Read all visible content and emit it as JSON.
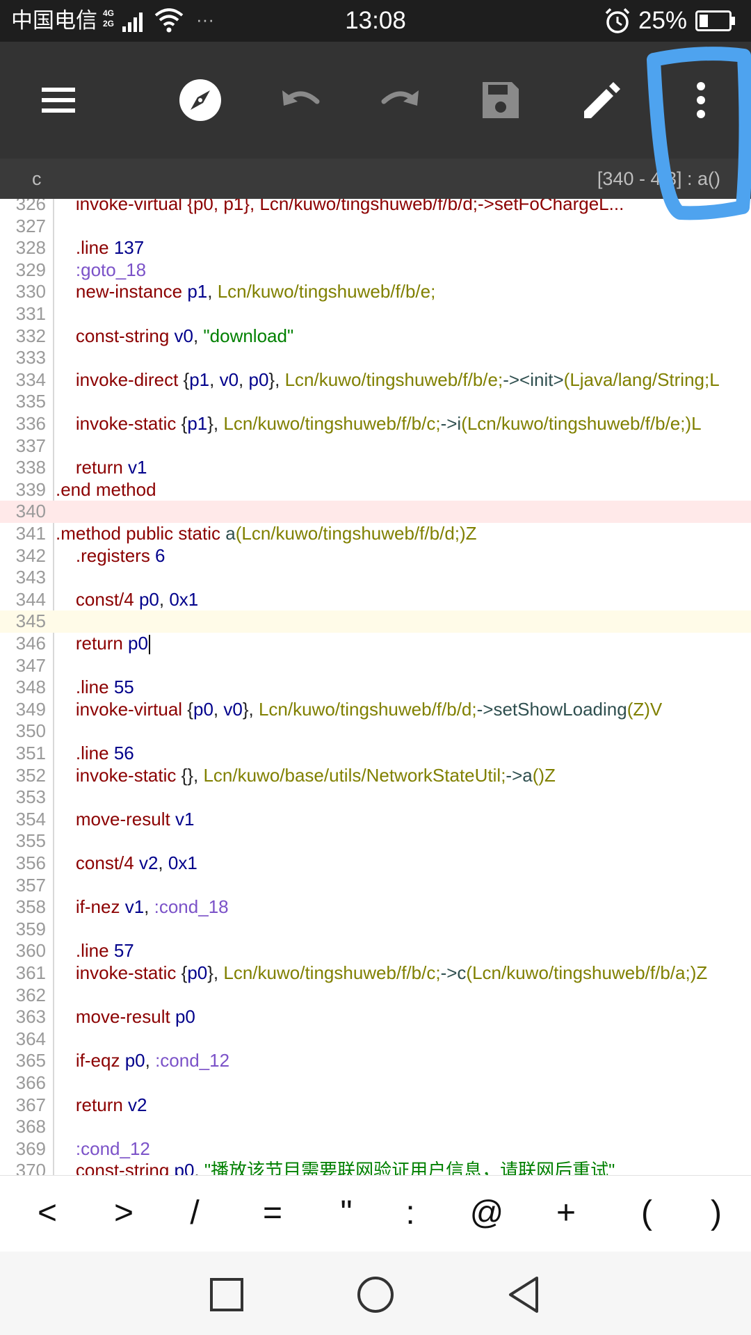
{
  "status_bar": {
    "carrier": "中国电信",
    "network_top": "4G",
    "network_bottom": "2G",
    "more": "···",
    "time": "13:08",
    "battery": "25%"
  },
  "toolbar": {
    "icons": [
      "menu-icon",
      "compass-icon",
      "undo-icon",
      "redo-icon",
      "save-icon",
      "edit-icon",
      "more-vert-icon"
    ]
  },
  "subheader": {
    "left": "c",
    "right": "[340 - 4 3] : a()"
  },
  "editor": {
    "lines": [
      {
        "n": "326",
        "tokens": [
          [
            "    invoke-virtual {p0, p1}, Lcn/kuwo/tingshuweb/f/b/d;->setFoChargeL...",
            "t-kw"
          ]
        ]
      },
      {
        "n": "327",
        "tokens": []
      },
      {
        "n": "328",
        "tokens": [
          [
            "    .line ",
            "t-kw"
          ],
          [
            "137",
            "t-num"
          ]
        ]
      },
      {
        "n": "329",
        "tokens": [
          [
            "    ",
            "t-p"
          ],
          [
            ":goto_18",
            "t-label"
          ]
        ]
      },
      {
        "n": "330",
        "tokens": [
          [
            "    new-instance ",
            "t-kw"
          ],
          [
            "p1",
            "t-reg"
          ],
          [
            ", ",
            "t-p"
          ],
          [
            "Lcn/kuwo/tingshuweb/f/b/e;",
            "t-type"
          ]
        ]
      },
      {
        "n": "331",
        "tokens": []
      },
      {
        "n": "332",
        "tokens": [
          [
            "    const-string ",
            "t-kw"
          ],
          [
            "v0",
            "t-reg"
          ],
          [
            ", ",
            "t-p"
          ],
          [
            "\"download\"",
            "t-str"
          ]
        ]
      },
      {
        "n": "333",
        "tokens": []
      },
      {
        "n": "334",
        "tokens": [
          [
            "    invoke-direct ",
            "t-kw"
          ],
          [
            "{",
            "t-p"
          ],
          [
            "p1",
            "t-reg"
          ],
          [
            ", ",
            "t-p"
          ],
          [
            "v0",
            "t-reg"
          ],
          [
            ", ",
            "t-p"
          ],
          [
            "p0",
            "t-reg"
          ],
          [
            "}, ",
            "t-p"
          ],
          [
            "Lcn/kuwo/tingshuweb/f/b/e;",
            "t-type"
          ],
          [
            "-><init>",
            "t-meth"
          ],
          [
            "(Ljava/lang/String;L",
            "t-type"
          ]
        ]
      },
      {
        "n": "335",
        "tokens": []
      },
      {
        "n": "336",
        "tokens": [
          [
            "    invoke-static ",
            "t-kw"
          ],
          [
            "{",
            "t-p"
          ],
          [
            "p1",
            "t-reg"
          ],
          [
            "}, ",
            "t-p"
          ],
          [
            "Lcn/kuwo/tingshuweb/f/b/c;",
            "t-type"
          ],
          [
            "->i",
            "t-meth"
          ],
          [
            "(Lcn/kuwo/tingshuweb/f/b/e;)L",
            "t-type"
          ]
        ]
      },
      {
        "n": "337",
        "tokens": []
      },
      {
        "n": "338",
        "tokens": [
          [
            "    return ",
            "t-kw"
          ],
          [
            "v1",
            "t-reg"
          ]
        ]
      },
      {
        "n": "339",
        "tokens": [
          [
            ".end method",
            "t-kw"
          ]
        ]
      },
      {
        "n": "340",
        "tokens": [],
        "hl": "red"
      },
      {
        "n": "341",
        "tokens": [
          [
            ".method public static ",
            "t-kw"
          ],
          [
            "a",
            "t-meth"
          ],
          [
            "(Lcn/kuwo/tingshuweb/f/b/d;)Z",
            "t-type"
          ]
        ]
      },
      {
        "n": "342",
        "tokens": [
          [
            "    .registers ",
            "t-kw"
          ],
          [
            "6",
            "t-num"
          ]
        ]
      },
      {
        "n": "343",
        "tokens": []
      },
      {
        "n": "344",
        "tokens": [
          [
            "    const/4 ",
            "t-kw"
          ],
          [
            "p0",
            "t-reg"
          ],
          [
            ", ",
            "t-p"
          ],
          [
            "0x1",
            "t-num"
          ]
        ]
      },
      {
        "n": "345",
        "tokens": [],
        "hl": "yel"
      },
      {
        "n": "346",
        "tokens": [
          [
            "    return ",
            "t-kw"
          ],
          [
            "p0",
            "t-reg"
          ]
        ],
        "caret": true
      },
      {
        "n": "347",
        "tokens": []
      },
      {
        "n": "348",
        "tokens": [
          [
            "    .line ",
            "t-kw"
          ],
          [
            "55",
            "t-num"
          ]
        ]
      },
      {
        "n": "349",
        "tokens": [
          [
            "    invoke-virtual ",
            "t-kw"
          ],
          [
            "{",
            "t-p"
          ],
          [
            "p0",
            "t-reg"
          ],
          [
            ", ",
            "t-p"
          ],
          [
            "v0",
            "t-reg"
          ],
          [
            "}, ",
            "t-p"
          ],
          [
            "Lcn/kuwo/tingshuweb/f/b/d;",
            "t-type"
          ],
          [
            "->setShowLoading",
            "t-meth"
          ],
          [
            "(Z)V",
            "t-type"
          ]
        ]
      },
      {
        "n": "350",
        "tokens": []
      },
      {
        "n": "351",
        "tokens": [
          [
            "    .line ",
            "t-kw"
          ],
          [
            "56",
            "t-num"
          ]
        ]
      },
      {
        "n": "352",
        "tokens": [
          [
            "    invoke-static ",
            "t-kw"
          ],
          [
            "{}, ",
            "t-p"
          ],
          [
            "Lcn/kuwo/base/utils/NetworkStateUtil;",
            "t-type"
          ],
          [
            "->a",
            "t-meth"
          ],
          [
            "()Z",
            "t-type"
          ]
        ]
      },
      {
        "n": "353",
        "tokens": []
      },
      {
        "n": "354",
        "tokens": [
          [
            "    move-result ",
            "t-kw"
          ],
          [
            "v1",
            "t-reg"
          ]
        ]
      },
      {
        "n": "355",
        "tokens": []
      },
      {
        "n": "356",
        "tokens": [
          [
            "    const/4 ",
            "t-kw"
          ],
          [
            "v2",
            "t-reg"
          ],
          [
            ", ",
            "t-p"
          ],
          [
            "0x1",
            "t-num"
          ]
        ]
      },
      {
        "n": "357",
        "tokens": []
      },
      {
        "n": "358",
        "tokens": [
          [
            "    if-nez ",
            "t-kw"
          ],
          [
            "v1",
            "t-reg"
          ],
          [
            ", ",
            "t-p"
          ],
          [
            ":cond_18",
            "t-label"
          ]
        ]
      },
      {
        "n": "359",
        "tokens": []
      },
      {
        "n": "360",
        "tokens": [
          [
            "    .line ",
            "t-kw"
          ],
          [
            "57",
            "t-num"
          ]
        ]
      },
      {
        "n": "361",
        "tokens": [
          [
            "    invoke-static ",
            "t-kw"
          ],
          [
            "{",
            "t-p"
          ],
          [
            "p0",
            "t-reg"
          ],
          [
            "}, ",
            "t-p"
          ],
          [
            "Lcn/kuwo/tingshuweb/f/b/c;",
            "t-type"
          ],
          [
            "->c",
            "t-meth"
          ],
          [
            "(Lcn/kuwo/tingshuweb/f/b/a;)Z",
            "t-type"
          ]
        ]
      },
      {
        "n": "362",
        "tokens": []
      },
      {
        "n": "363",
        "tokens": [
          [
            "    move-result ",
            "t-kw"
          ],
          [
            "p0",
            "t-reg"
          ]
        ]
      },
      {
        "n": "364",
        "tokens": []
      },
      {
        "n": "365",
        "tokens": [
          [
            "    if-eqz ",
            "t-kw"
          ],
          [
            "p0",
            "t-reg"
          ],
          [
            ", ",
            "t-p"
          ],
          [
            ":cond_12",
            "t-label"
          ]
        ]
      },
      {
        "n": "366",
        "tokens": []
      },
      {
        "n": "367",
        "tokens": [
          [
            "    return ",
            "t-kw"
          ],
          [
            "v2",
            "t-reg"
          ]
        ]
      },
      {
        "n": "368",
        "tokens": []
      },
      {
        "n": "369",
        "tokens": [
          [
            "    ",
            "t-p"
          ],
          [
            ":cond_12",
            "t-label"
          ]
        ]
      },
      {
        "n": "370",
        "tokens": [
          [
            "    const-string ",
            "t-kw"
          ],
          [
            "p0",
            "t-reg"
          ],
          [
            ", ",
            "t-p"
          ],
          [
            "\"播放该节目需要联网验证用户信息，请联网后重试\"",
            "t-str"
          ]
        ]
      }
    ]
  },
  "symbol_bar": {
    "symbols": [
      "<",
      ">",
      "/",
      "=",
      "\"",
      ":",
      "@",
      "+",
      "(",
      ")"
    ]
  },
  "nav_bar": {
    "buttons": [
      "recents-button",
      "home-button",
      "back-button"
    ]
  }
}
